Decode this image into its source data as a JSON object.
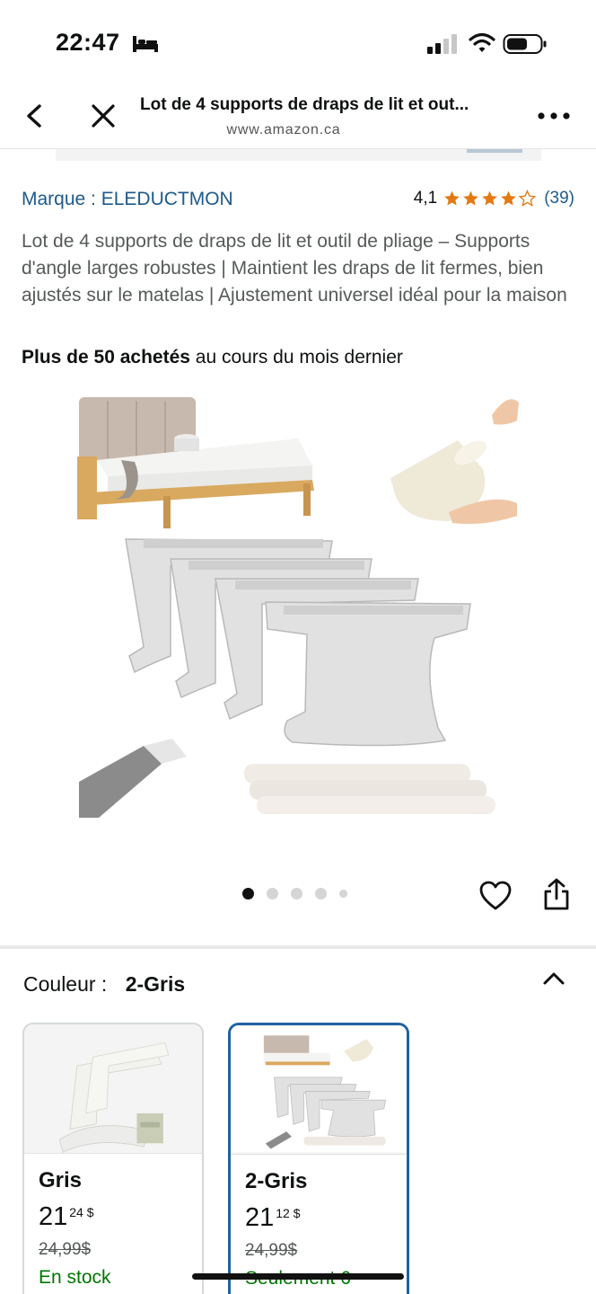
{
  "status_bar": {
    "time": "22:47"
  },
  "header": {
    "title": "Lot de 4 supports de draps de lit et out...",
    "url": "www.amazon.ca"
  },
  "product": {
    "brand": "Marque : ELEDUCTMON",
    "rating_value": "4,1",
    "rating_stars": 4.1,
    "rating_count": "(39)",
    "title": "Lot de 4 supports de draps de lit et outil de pliage – Supports d'angle larges robustes | Maintient les draps de lit fermes, bien ajustés sur le matelas | Ajustement universel idéal pour la maison",
    "bought_bold": "Plus de 50 achetés",
    "bought_rest": " au cours du mois dernier"
  },
  "carousel": {
    "total_dots": 5,
    "active_index": 0
  },
  "color_selector": {
    "label": "Couleur :",
    "selected": "2-Gris",
    "variants": [
      {
        "name": "Gris",
        "price_main": "21",
        "price_sup": "24 $",
        "old_price": "24,99$",
        "stock": "En stock"
      },
      {
        "name": "2-Gris",
        "price_main": "21",
        "price_sup": "12 $",
        "old_price": "24,99$",
        "stock": "Seulement 6"
      }
    ]
  },
  "colors": {
    "link": "#1d5a8c",
    "star": "#e47911",
    "stock_green": "#007600",
    "selected_border": "#2162a1"
  }
}
